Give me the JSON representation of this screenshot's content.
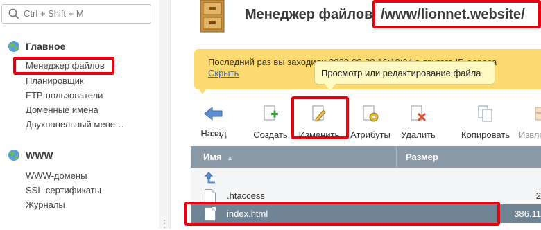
{
  "sidebar": {
    "search_placeholder": "Ctrl + Shift + M",
    "sections": [
      {
        "title": "Главное",
        "items": [
          "Менеджер файлов",
          "Планировщик",
          "FTP-пользователи",
          "Доменные имена",
          "Двухпанельный мене…"
        ]
      },
      {
        "title": "WWW",
        "items": [
          "WWW-домены",
          "SSL-сертификаты",
          "Журналы"
        ]
      }
    ]
  },
  "header": {
    "title_prefix": "Менеджер файлов",
    "path": "/www/lionnet.website/"
  },
  "banner": {
    "text": "Последний раз вы заходили 2020-09-29 16:18:34 с другого IP-адреса",
    "hide_link": "Скрыть"
  },
  "tooltip": "Просмотр или редактирование файла",
  "toolbar": {
    "back": "Назад",
    "create": "Создать",
    "edit": "Изменить",
    "attributes": "Атрибуты",
    "delete": "Удалить",
    "copy": "Копировать",
    "extract": "Извлечь"
  },
  "table": {
    "columns": [
      "Имя",
      "Размер"
    ],
    "sort_indicator": "▲",
    "up_icon": "folder-up-icon",
    "rows": [
      {
        "name": ".htaccess",
        "size": "2"
      },
      {
        "name": "index.html",
        "size": "386.11"
      }
    ]
  },
  "colors": {
    "highlight_red": "#e8000f",
    "banner_yellow": "#fdda71",
    "table_header": "#8a9aa9",
    "selected_row": "#6f8495"
  }
}
